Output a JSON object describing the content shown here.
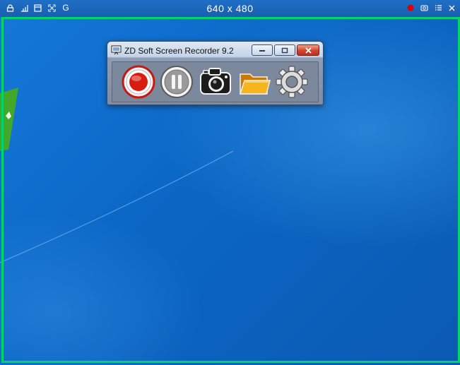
{
  "toolbar": {
    "size_label": "640 x 480",
    "left_icons": [
      "lock-icon",
      "resize-corner-icon",
      "window-icon",
      "fullscreen-icon",
      "g-icon"
    ],
    "g_label": "G",
    "right_icons": [
      "record-dot-icon",
      "camera-icon",
      "menu-icon",
      "close-icon"
    ]
  },
  "recorder": {
    "title": "ZD Soft Screen Recorder 9.2",
    "buttons": [
      "record",
      "pause",
      "screenshot",
      "open-folder",
      "settings"
    ]
  },
  "colors": {
    "frame": "#00d46a",
    "desktop": "#0b66c4",
    "record_red": "#e00000",
    "folder": "#f2a516"
  }
}
